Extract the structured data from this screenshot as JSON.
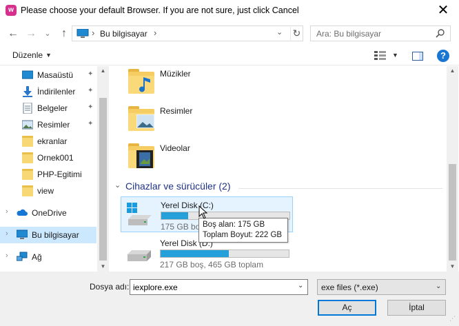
{
  "window": {
    "title": "Please choose your default Browser. If you are not sure, just click Cancel",
    "app_icon_letter": "w",
    "close_glyph": "✕"
  },
  "nav": {
    "back_glyph": "←",
    "forward_glyph": "→",
    "recent_glyph": "⌄",
    "up_glyph": "↑"
  },
  "address": {
    "separator": "›",
    "current": "Bu bilgisayar",
    "refresh_glyph": "↻",
    "dropdown_glyph": "⌄"
  },
  "search": {
    "placeholder": "Ara: Bu bilgisayar"
  },
  "toolbar": {
    "organize_label": "Düzenle",
    "caret": "▼",
    "help_label": "?"
  },
  "sidebar": {
    "items": [
      {
        "label": "Masaüstü",
        "icon": "desktop-icon",
        "pinned": true
      },
      {
        "label": "İndirilenler",
        "icon": "download-icon",
        "pinned": true
      },
      {
        "label": "Belgeler",
        "icon": "documents-icon",
        "pinned": true
      },
      {
        "label": "Resimler",
        "icon": "pictures-icon",
        "pinned": true
      },
      {
        "label": "ekranlar",
        "icon": "folder-icon",
        "pinned": false
      },
      {
        "label": "Ornek001",
        "icon": "folder-icon",
        "pinned": false
      },
      {
        "label": "PHP-Egitimi",
        "icon": "folder-icon",
        "pinned": false
      },
      {
        "label": "view",
        "icon": "folder-icon",
        "pinned": false
      },
      {
        "label": "OneDrive",
        "icon": "cloud-icon",
        "pinned": false
      },
      {
        "label": "Bu bilgisayar",
        "icon": "computer-icon",
        "pinned": false,
        "selected": true
      },
      {
        "label": "Ağ",
        "icon": "network-icon",
        "pinned": false
      }
    ],
    "pin_glyph": "📌",
    "expand_glyph": "›"
  },
  "main": {
    "folders": [
      {
        "label": "Müzikler",
        "icon": "music-folder-icon"
      },
      {
        "label": "Resimler",
        "icon": "pictures-folder-icon"
      },
      {
        "label": "Videolar",
        "icon": "videos-folder-icon"
      }
    ],
    "group_header": "Cihazlar ve sürücüler (2)",
    "group_chevron": "⌄",
    "drives": [
      {
        "name": "Yerel Disk (C:)",
        "info": "175 GB boş",
        "used_fraction": 0.21,
        "hovered": true
      },
      {
        "name": "Yerel Disk (D:)",
        "info": "217 GB boş, 465 GB toplam",
        "used_fraction": 0.53,
        "hovered": false
      }
    ],
    "tooltip": {
      "free": "Boş alan: 175 GB",
      "total": "Toplam Boyut: 222 GB"
    }
  },
  "bottom": {
    "filename_label": "Dosya adı:",
    "filename_value": "iexplore.exe",
    "filetype_value": "exe files (*.exe)",
    "ok_label": "Aç",
    "cancel_label": "İptal"
  },
  "colors": {
    "accent": "#0078d7",
    "selected_bg": "#cce8ff",
    "drive_fill": "#26a0da",
    "group_header": "#1e3287"
  }
}
